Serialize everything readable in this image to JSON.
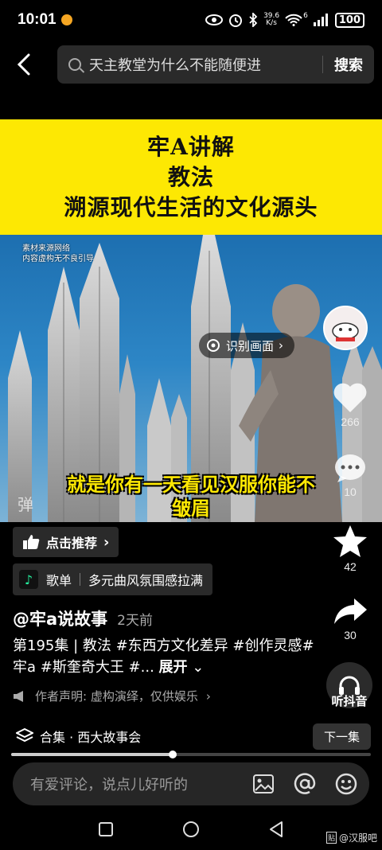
{
  "status_bar": {
    "time": "10:01",
    "speed_value": "39.6",
    "speed_unit": "K/s",
    "signal_label": "6",
    "battery": "100"
  },
  "search": {
    "back_icon": "back-arrow-icon",
    "query": "天主教堂为什么不能随便进",
    "submit_label": "搜索"
  },
  "video": {
    "banner_lines": [
      "牢A讲解",
      "教法",
      "溯源现代生活的文化源头"
    ],
    "watermark_lines": [
      "素材来源网络",
      "内容虚构无不良引导"
    ],
    "recognize_label": "识别画面",
    "subtitle_lines": [
      "就是你有一天看见汉服你能不",
      "皱眉"
    ],
    "danmu_label": "弹",
    "colors": {
      "banner": "#fde803",
      "subtitle": "#fde803",
      "sky": "#2d86c6"
    }
  },
  "rail": {
    "like_count": "266",
    "comment_count": "10",
    "favorite_count": "42",
    "share_count": "30",
    "listen_label": "听抖音"
  },
  "recommend_label": "点击推荐",
  "playlist": {
    "label": "歌单",
    "title": "多元曲风氛围感拉满"
  },
  "post": {
    "author": "@牢a说故事",
    "time": "2天前",
    "caption": "第195集 | 教法 #东西方文化差异 #创作灵感#牢a #斯奎奇大王 #...",
    "expand_label": "展开",
    "disclaimer": "作者声明: 虚构演绎，仅供娱乐"
  },
  "collection": {
    "label": "合集 · 西大故事会",
    "next_label": "下一集",
    "progress": 0.45
  },
  "comment": {
    "placeholder": "有爱评论，说点儿好听的"
  },
  "corner_tag": {
    "box": "贴",
    "text": "@汉服吧"
  }
}
